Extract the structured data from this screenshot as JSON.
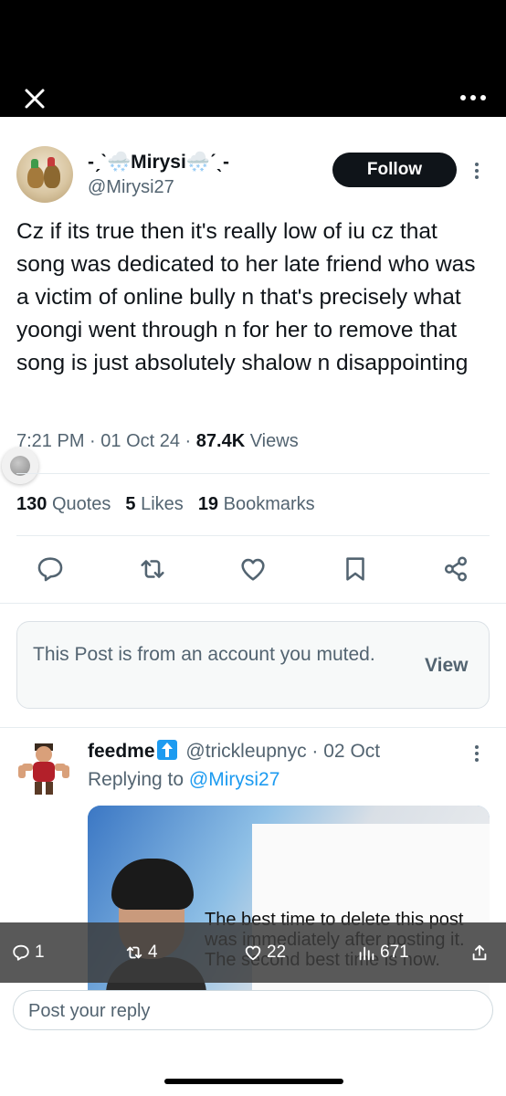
{
  "header": {
    "close_icon": "close-icon",
    "more_icon": "more-horizontal-icon"
  },
  "post": {
    "display_name": "-ˏˋ🌨️Mirysi🌨️ˊˎ-",
    "handle": "@Mirysi27",
    "follow_label": "Follow",
    "text": "Cz if its true then it's really low of iu cz that song was dedicated to her late friend who was a victim of online bully n that's precisely what yoongi went through n for her to remove that song is just absolutely shalow n disappointing",
    "time": "7:21 PM",
    "date": "01 Oct 24",
    "views_count": "87.4K",
    "views_label": "Views",
    "quotes_count": "130",
    "quotes_label": "Quotes",
    "likes_count": "5",
    "likes_label": "Likes",
    "bookmarks_count": "19",
    "bookmarks_label": "Bookmarks"
  },
  "muted_notice": {
    "text": "This Post is from an account you muted.",
    "view_label": "View"
  },
  "reply": {
    "display_name": "feedme",
    "handle": "@trickleupnyc",
    "date": "02 Oct",
    "replying_prefix": "Replying to",
    "replying_to": "@Mirysi27",
    "media_caption": "The best time to delete this post was immediately after posting it. The second best time is now.",
    "reply_count": "1",
    "repost_count": "4",
    "like_count": "22",
    "view_count": "671"
  },
  "composer": {
    "placeholder": "Post your reply"
  },
  "colors": {
    "accent": "#1d9bf0",
    "text": "#0f1419",
    "secondary": "#536471",
    "follow_bg": "#0f1419"
  }
}
